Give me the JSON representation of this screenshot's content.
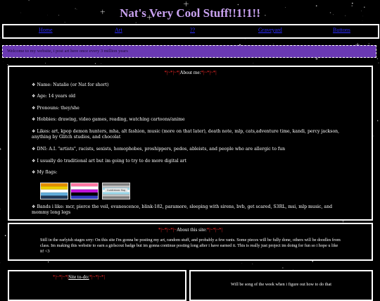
{
  "title": "Nat's Very Cool Stuff!!1!1!!",
  "nav": [
    "Home",
    "Art",
    "??",
    "Graveyard",
    "Buttons"
  ],
  "welcome": "Welcome to my website, i post art here once every 3 million years",
  "about_me": {
    "heading_deco_left": "*|~*|~*|",
    "heading": "About me:",
    "heading_deco_right": "*|~*|~*|",
    "items": [
      "❖ Name: Natalie (or Nat for short)",
      "❖ Age: 14 years old",
      "❖ Pronouns: they/she",
      "❖ Hobbies: drawing, video games, reading, watching cartoons/anime",
      "❖ Likes: art, kpop demon hunters, mha, alt fashion, music (more on that later), death note, mlp, cats,adventure time, kandi, percy jackson, anything by Glitch studios, and chocolat",
      "❖ DNI: A.I. \"artists\", racists, sexists, homophobes, proshippers, pedos, ableists, and people who are allergic to fun",
      "❖ I usually do traditional art but im going to try to do more digital art",
      "❖ My flags:",
      "❖ Bands i like: mcr, pierce the veil, evanescence, blink-182, paramore, sleeping with sirens, bvb, get scared, S3RL, msi, mlp music, and mommy long legs"
    ],
    "flags": [
      {
        "name": "aroace-flag",
        "colors": [
          "#e38d00",
          "#edce00",
          "#ffffff",
          "#62aedc",
          "#203856"
        ]
      },
      {
        "name": "genderfluid-flag",
        "colors": [
          "#fe76a2",
          "#ffffff",
          "#bf12d7",
          "#000000",
          "#303cbe"
        ]
      },
      {
        "name": "demiboy-flag",
        "colors": [
          "#7f7f7f",
          "#c3c3c3",
          "#9ad9eb",
          "#ffffff",
          "#9ad9eb",
          "#c3c3c3",
          "#7f7f7f"
        ],
        "text": "Cuddlebear flag"
      }
    ]
  },
  "about_site": {
    "heading_deco_left": "*|~*|~*|~",
    "heading": "About this site:",
    "heading_deco_right": "*|~*|~*|",
    "text": "Still in the earlyish stages srry: On this site I'm gonna be posting my art, random stuff, and probably a few rants. Some pieces will be fully done, others will be doodles from class. Im making this website to earn a girlscout badge but im gonna continue posting long after i have earned it. This is really just project im doing for fun so i hope u like it! <3"
  },
  "todo": {
    "heading_deco_left": "*|~*|~*|",
    "heading": "Site to-do:",
    "heading_deco_right": "*|~*|~*|"
  },
  "note": {
    "text": "Will be song of the week when i figure out how to do that"
  },
  "colors": {
    "title": "#c9a2f0",
    "nav_link": "#2c2cff",
    "welcome_bg": "#6a39b3",
    "deco": "#ff2a2a"
  }
}
